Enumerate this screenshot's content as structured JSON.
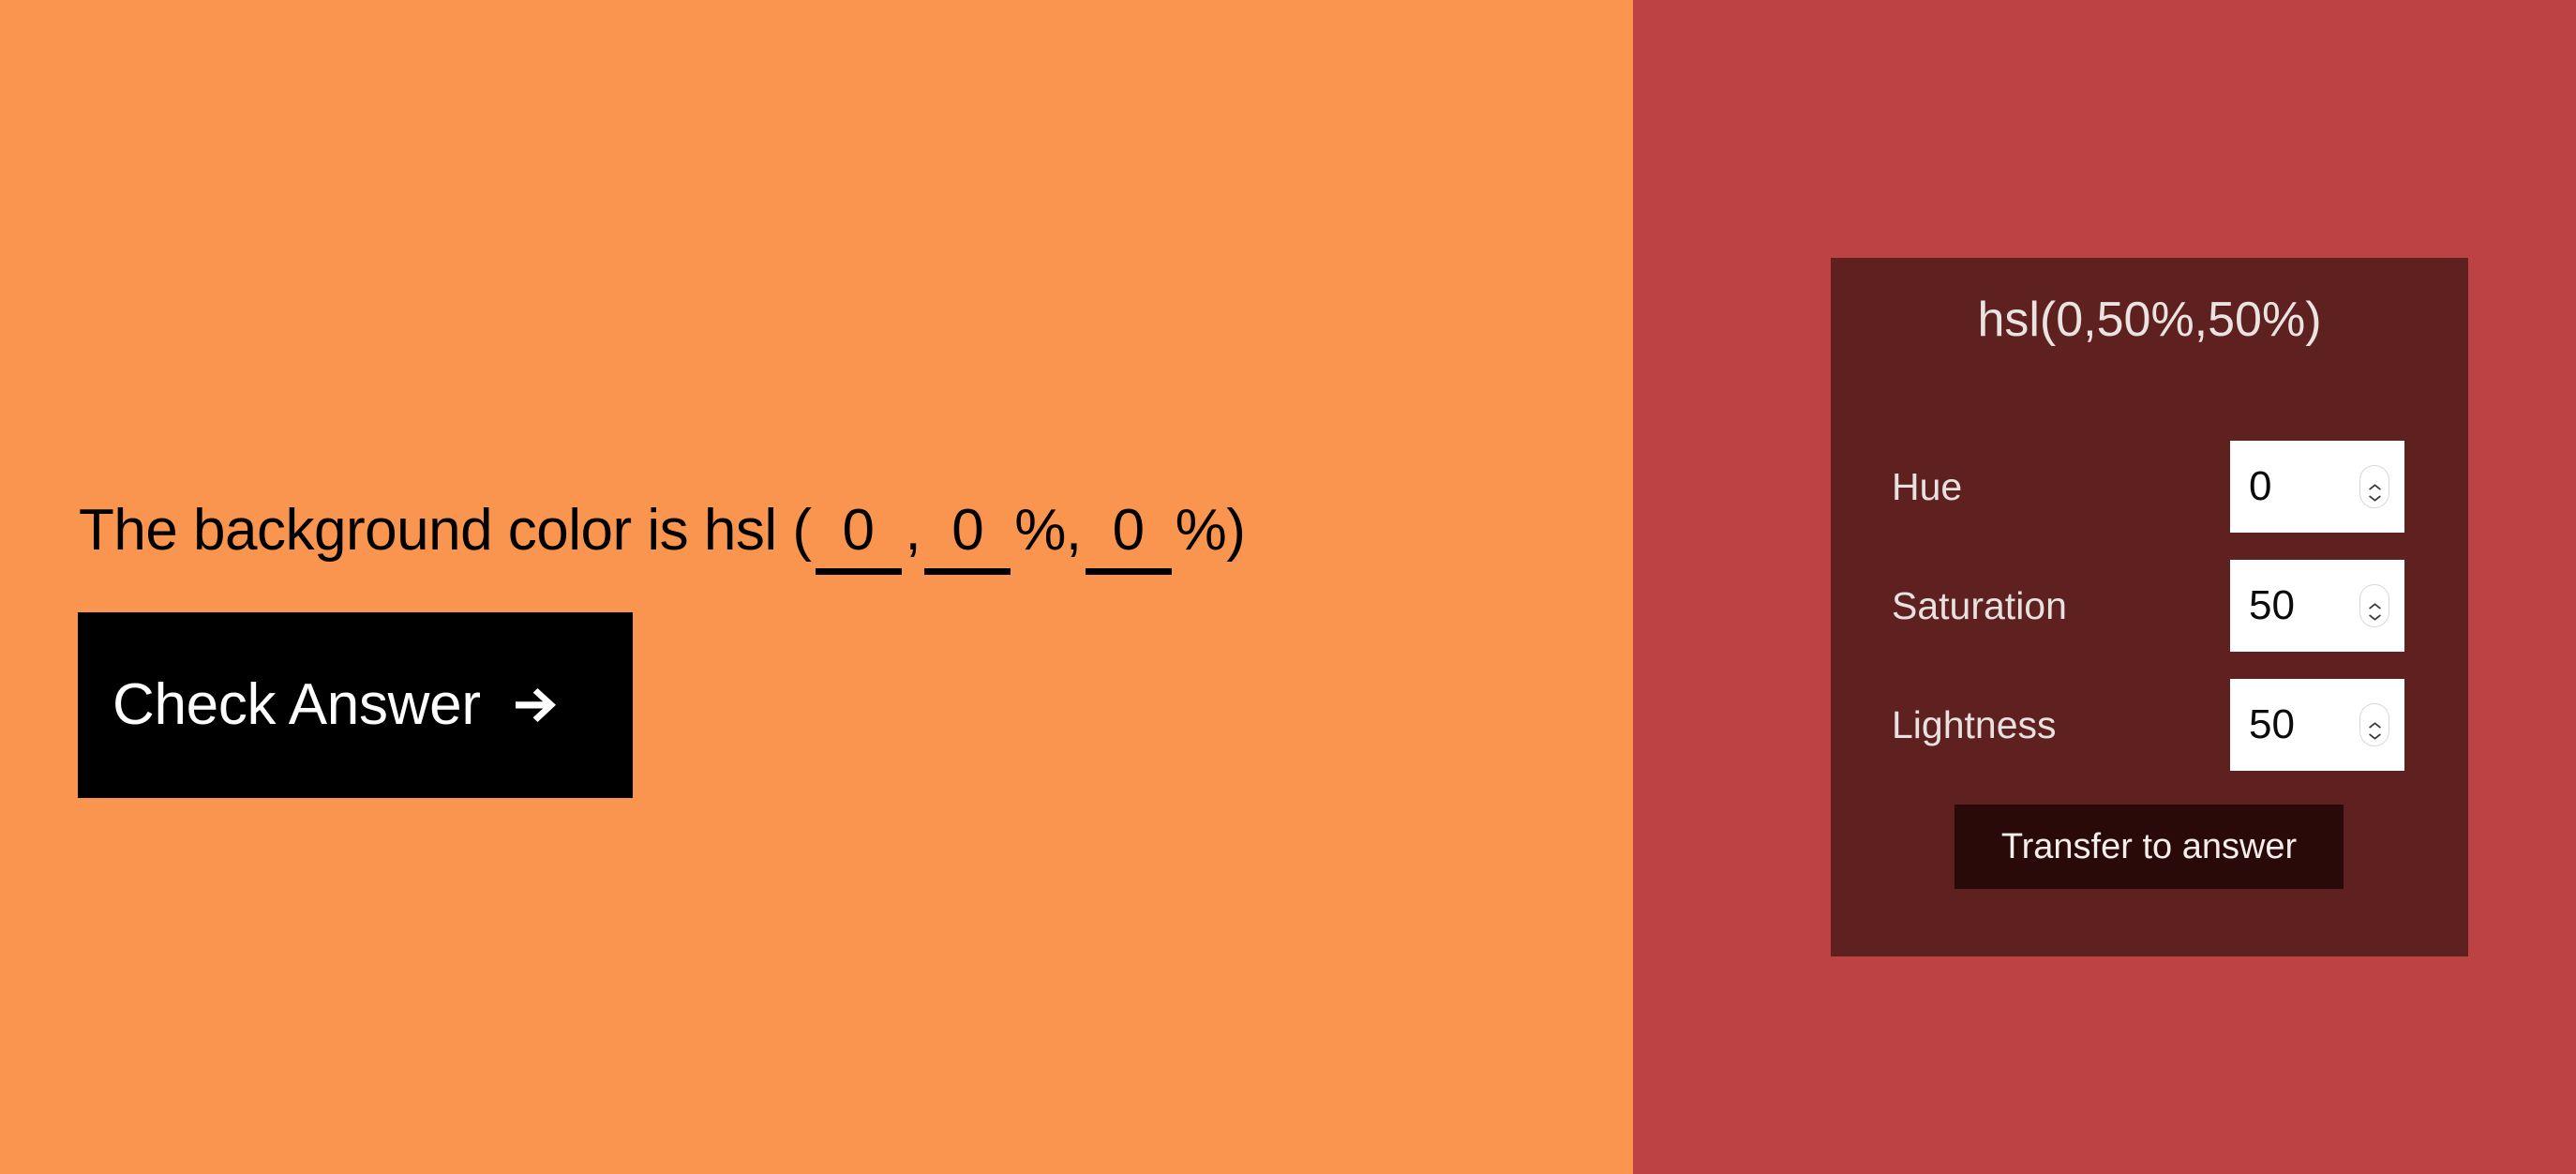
{
  "colors": {
    "swatch_background": "#f9954f",
    "panel_background": "#bd4244",
    "card_background": "#5f2120",
    "check_button_background": "#000000",
    "transfer_button_background": "#2a0a09",
    "input_background": "#ffffff",
    "card_text": "#e9e3e1"
  },
  "question": {
    "prefix": "The background color is hsl (",
    "separator_comma": ",",
    "percent_sign": "%",
    "percent_sign_comma": "%,",
    "suffix": "%)",
    "hue_value": "0",
    "saturation_value": "0",
    "lightness_value": "0"
  },
  "check_button": {
    "label": "Check Answer",
    "arrow_glyph": "arrow-right-icon"
  },
  "card": {
    "title": "hsl(0,50%,50%)",
    "fields": [
      {
        "label": "Hue",
        "value": "0"
      },
      {
        "label": "Saturation",
        "value": "50"
      },
      {
        "label": "Lightness",
        "value": "50"
      }
    ],
    "transfer_button_label": "Transfer to answer"
  }
}
